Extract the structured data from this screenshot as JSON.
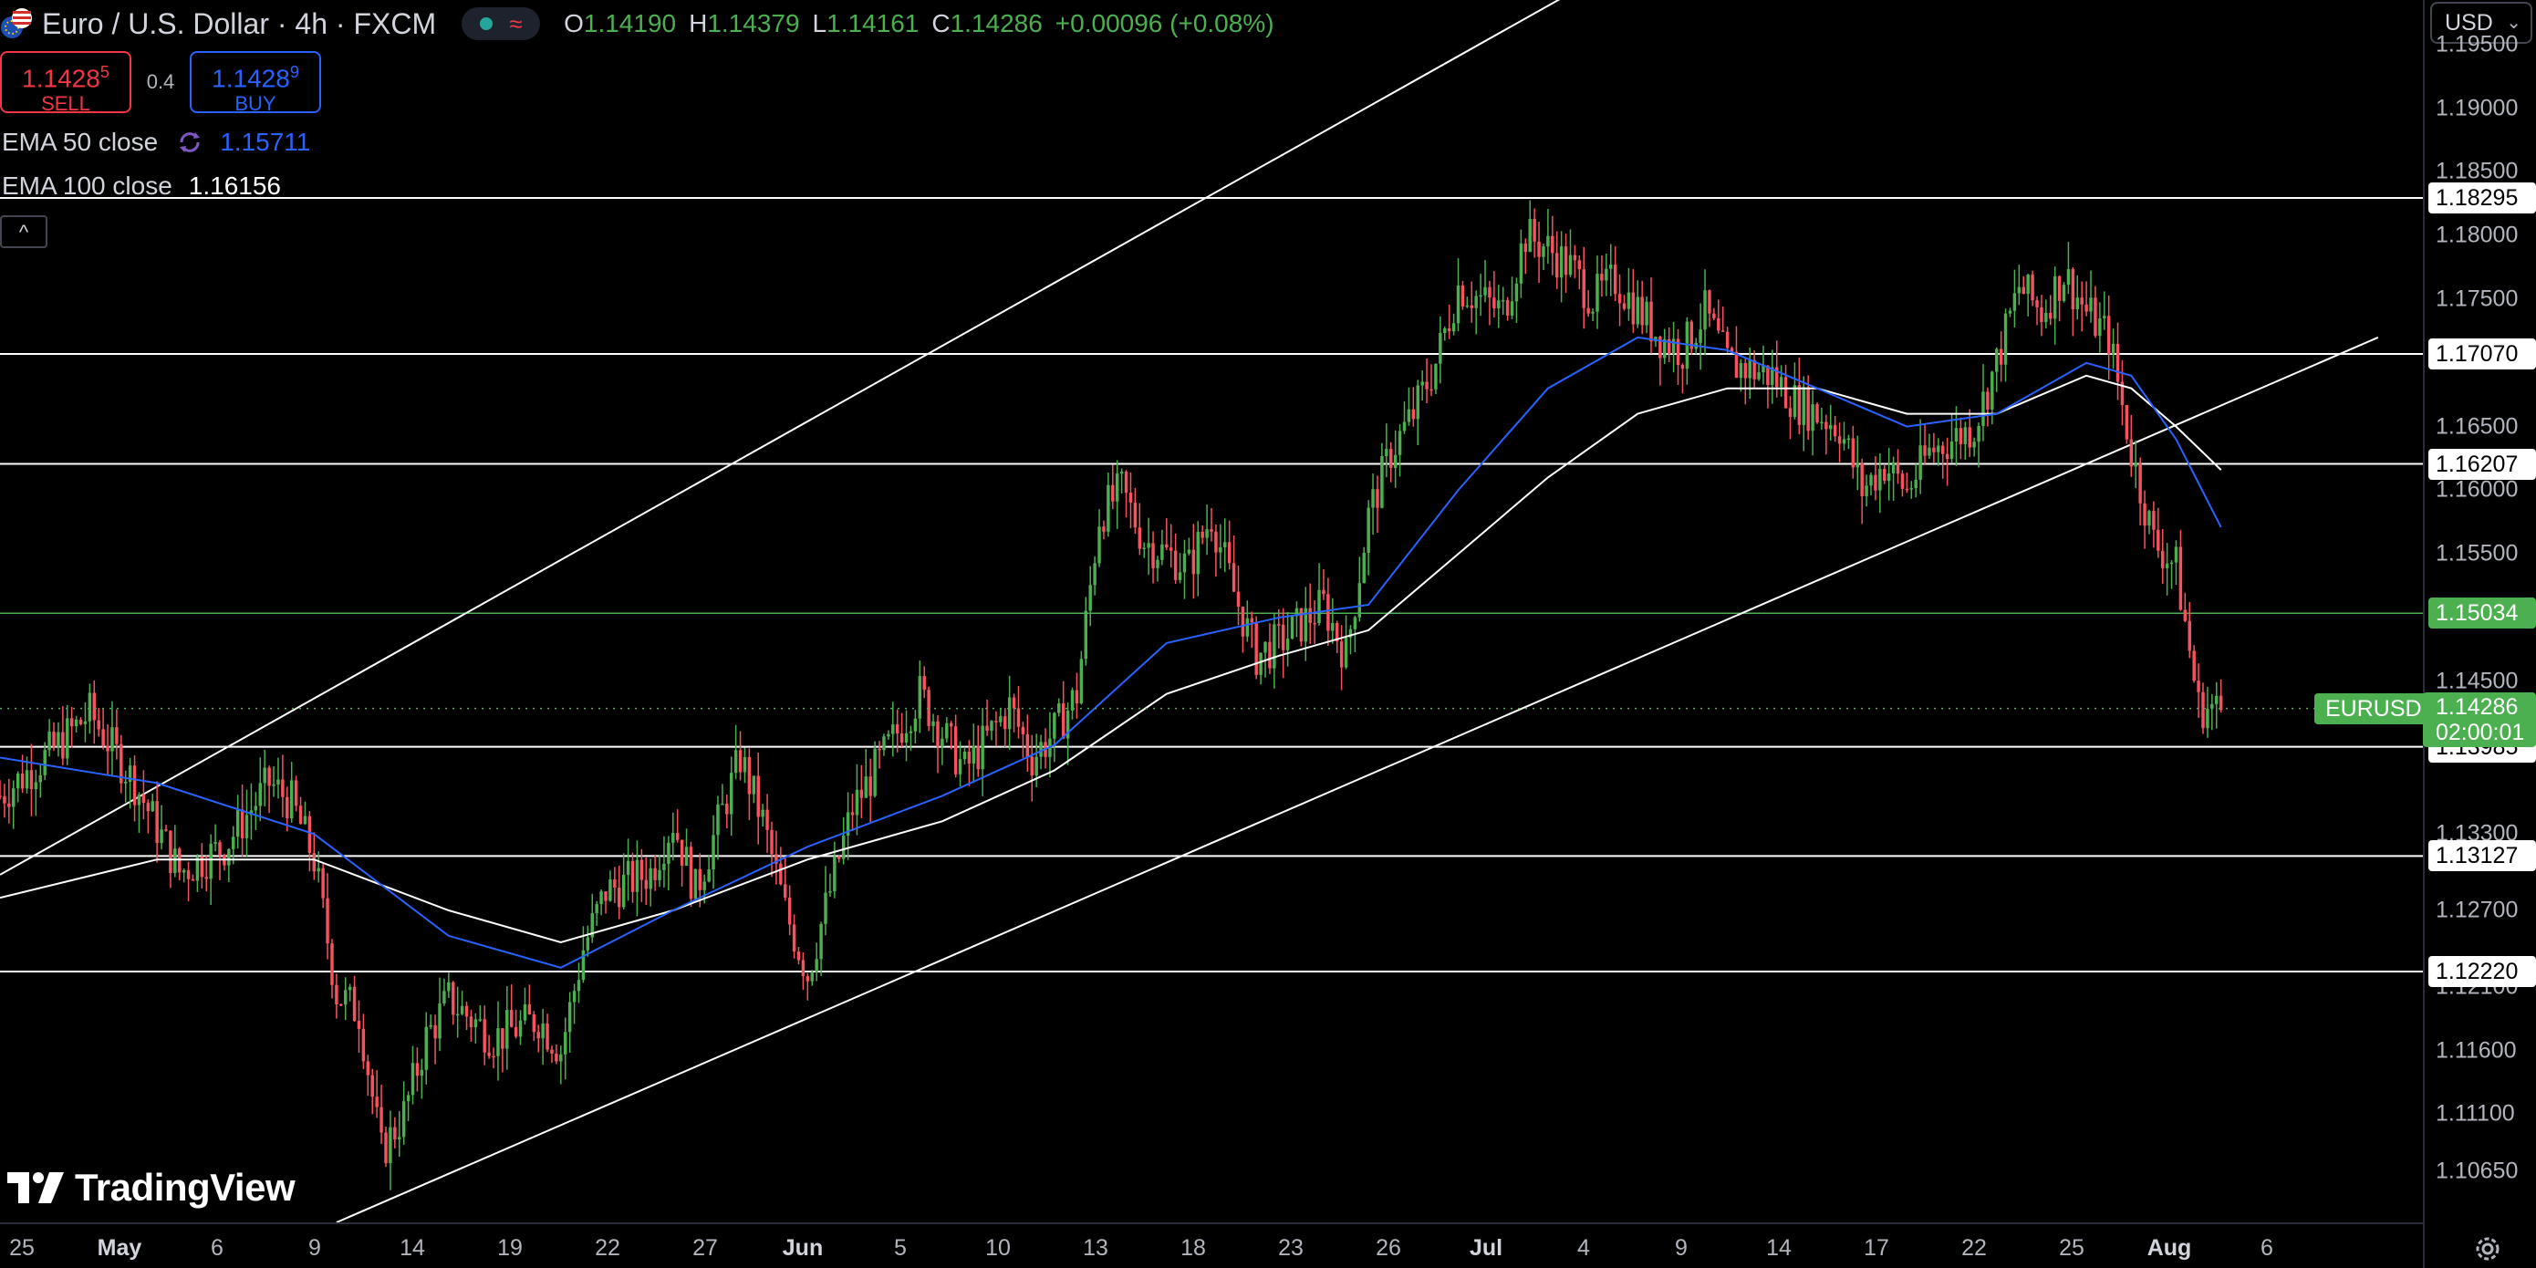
{
  "header": {
    "title": "Euro / U.S. Dollar · 4h · FXCM",
    "ohlc": [
      {
        "key": "O",
        "value": "1.14190"
      },
      {
        "key": "H",
        "value": "1.14379"
      },
      {
        "key": "L",
        "value": "1.14161"
      },
      {
        "key": "C",
        "value": "1.14286"
      }
    ],
    "change": "+0.00096 (+0.08%)",
    "status_icons": [
      "market-open-dot-icon",
      "data-delay-wave-icon"
    ]
  },
  "trade": {
    "sell_price_main": "1.1428",
    "sell_price_pip": "5",
    "sell_label": "SELL",
    "spread": "0.4",
    "buy_price_main": "1.1428",
    "buy_price_pip": "9",
    "buy_label": "BUY"
  },
  "indicators": {
    "ema50_label": "EMA 50 close",
    "ema50_value": "1.15711",
    "ema100_label": "EMA 100 close",
    "ema100_value": "1.16156",
    "collapse_glyph": "^"
  },
  "price_axis": {
    "currency": "USD",
    "ticks": [
      "1.19500",
      "1.19000",
      "1.18500",
      "1.18000",
      "1.17500",
      "1.16500",
      "1.16000",
      "1.15500",
      "1.14500",
      "1.13300",
      "1.12700",
      "1.12100",
      "1.11600",
      "1.11100",
      "1.10650"
    ],
    "last_price": "1.14286",
    "countdown": "02:00:01",
    "symbol": "EURUSD"
  },
  "time_axis": {
    "ticks": [
      {
        "label": "25",
        "bold": false
      },
      {
        "label": "May",
        "bold": true
      },
      {
        "label": "6",
        "bold": false
      },
      {
        "label": "9",
        "bold": false
      },
      {
        "label": "14",
        "bold": false
      },
      {
        "label": "19",
        "bold": false
      },
      {
        "label": "22",
        "bold": false
      },
      {
        "label": "27",
        "bold": false
      },
      {
        "label": "Jun",
        "bold": true
      },
      {
        "label": "5",
        "bold": false
      },
      {
        "label": "10",
        "bold": false
      },
      {
        "label": "13",
        "bold": false
      },
      {
        "label": "18",
        "bold": false
      },
      {
        "label": "23",
        "bold": false
      },
      {
        "label": "26",
        "bold": false
      },
      {
        "label": "Jul",
        "bold": true
      },
      {
        "label": "4",
        "bold": false
      },
      {
        "label": "9",
        "bold": false
      },
      {
        "label": "14",
        "bold": false
      },
      {
        "label": "17",
        "bold": false
      },
      {
        "label": "22",
        "bold": false
      },
      {
        "label": "25",
        "bold": false
      },
      {
        "label": "Aug",
        "bold": true
      },
      {
        "label": "6",
        "bold": false
      }
    ]
  },
  "colors": {
    "up": "#4caf50",
    "down": "#f7525f",
    "ema50": "#2962ff",
    "ema100": "#ffffff",
    "level_line": "#ffffff",
    "level_green": "#4caf50"
  },
  "branding": {
    "logo_text": "TradingView"
  },
  "chart_data": {
    "type": "candlestick",
    "instrument": "EURUSD",
    "timeframe": "4h",
    "ylim": [
      1.1025,
      1.1985
    ],
    "horizontal_levels": [
      {
        "price": "1.18295",
        "color": "white"
      },
      {
        "price": "1.17070",
        "color": "white"
      },
      {
        "price": "1.16207",
        "color": "white"
      },
      {
        "price": "1.15034",
        "color": "green"
      },
      {
        "price": "1.13985",
        "color": "white"
      },
      {
        "price": "1.13127",
        "color": "white"
      },
      {
        "price": "1.12220",
        "color": "white"
      }
    ],
    "channel": {
      "upper": [
        [
          "Apr 24",
          1.1298
        ],
        [
          "Jul 6",
          1.202
        ]
      ],
      "lower": [
        [
          "May 9",
          1.1025
        ],
        [
          "Aug 8",
          1.172
        ]
      ]
    },
    "ohlc_path": [
      [
        "Apr 24",
        1.136
      ],
      [
        "Apr 26",
        1.139
      ],
      [
        "Apr 28",
        1.1425
      ],
      [
        "Apr 30",
        1.137
      ],
      [
        "May 2",
        1.13
      ],
      [
        "May 4",
        1.132
      ],
      [
        "May 6",
        1.137
      ],
      [
        "May 7",
        1.1355
      ],
      [
        "May 8",
        1.131
      ],
      [
        "May 9",
        1.1205
      ],
      [
        "May 10",
        1.119
      ],
      [
        "May 11",
        1.108
      ],
      [
        "May 12",
        1.111
      ],
      [
        "May 13",
        1.117
      ],
      [
        "May 14",
        1.12
      ],
      [
        "May 16",
        1.117
      ],
      [
        "May 18",
        1.1185
      ],
      [
        "May 19",
        1.116
      ],
      [
        "May 20",
        1.124
      ],
      [
        "May 21",
        1.1285
      ],
      [
        "May 23",
        1.13
      ],
      [
        "May 24",
        1.134
      ],
      [
        "May 25",
        1.1285
      ],
      [
        "May 27",
        1.139
      ],
      [
        "May 28",
        1.134
      ],
      [
        "May 29",
        1.127
      ],
      [
        "May 30",
        1.122
      ],
      [
        "Jun 1",
        1.135
      ],
      [
        "Jun 3",
        1.141
      ],
      [
        "Jun 4",
        1.144
      ],
      [
        "Jun 6",
        1.138
      ],
      [
        "Jun 8",
        1.143
      ],
      [
        "Jun 9",
        1.139
      ],
      [
        "Jun 10",
        1.141
      ],
      [
        "Jun 11",
        1.144
      ],
      [
        "Jun 12",
        1.158
      ],
      [
        "Jun 13",
        1.16
      ],
      [
        "Jun 14",
        1.156
      ],
      [
        "Jun 16",
        1.154
      ],
      [
        "Jun 17",
        1.158
      ],
      [
        "Jun 18",
        1.152
      ],
      [
        "Jun 19",
        1.147
      ],
      [
        "Jun 20",
        1.148
      ],
      [
        "Jun 22",
        1.151
      ],
      [
        "Jun 23",
        1.147
      ],
      [
        "Jun 24",
        1.158
      ],
      [
        "Jun 25",
        1.163
      ],
      [
        "Jun 26",
        1.166
      ],
      [
        "Jun 27",
        1.17
      ],
      [
        "Jun 28",
        1.176
      ],
      [
        "Jun 30",
        1.174
      ],
      [
        "Jul 1",
        1.18
      ],
      [
        "Jul 2",
        1.179
      ],
      [
        "Jul 3",
        1.1775
      ],
      [
        "Jul 4",
        1.175
      ],
      [
        "Jul 5",
        1.1765
      ],
      [
        "Jul 7",
        1.172
      ],
      [
        "Jul 8",
        1.171
      ],
      [
        "Jul 9",
        1.174
      ],
      [
        "Jul 10",
        1.17
      ],
      [
        "Jul 12",
        1.169
      ],
      [
        "Jul 13",
        1.167
      ],
      [
        "Jul 14",
        1.166
      ],
      [
        "Jul 15",
        1.165
      ],
      [
        "Jul 16",
        1.16
      ],
      [
        "Jul 17",
        1.162
      ],
      [
        "Jul 18",
        1.16
      ],
      [
        "Jul 19",
        1.163
      ],
      [
        "Jul 21",
        1.165
      ],
      [
        "Jul 22",
        1.17
      ],
      [
        "Jul 23",
        1.176
      ],
      [
        "Jul 24",
        1.174
      ],
      [
        "Jul 25",
        1.177
      ],
      [
        "Jul 26",
        1.174
      ],
      [
        "Jul 27",
        1.172
      ],
      [
        "Jul 28",
        1.163
      ],
      [
        "Jul 29",
        1.156
      ],
      [
        "Jul 30",
        1.154
      ],
      [
        "Jul 31",
        1.143
      ],
      [
        "Aug 1",
        1.1428
      ]
    ],
    "ema50": [
      [
        "Apr 24",
        1.139
      ],
      [
        "May 1",
        1.137
      ],
      [
        "May 8",
        1.133
      ],
      [
        "May 14",
        1.125
      ],
      [
        "May 19",
        1.1225
      ],
      [
        "May 24",
        1.127
      ],
      [
        "May 30",
        1.132
      ],
      [
        "Jun 5",
        1.136
      ],
      [
        "Jun 10",
        1.14
      ],
      [
        "Jun 15",
        1.148
      ],
      [
        "Jun 20",
        1.15
      ],
      [
        "Jun 24",
        1.151
      ],
      [
        "Jun 28",
        1.16
      ],
      [
        "Jul 2",
        1.168
      ],
      [
        "Jul 6",
        1.172
      ],
      [
        "Jul 10",
        1.171
      ],
      [
        "Jul 14",
        1.168
      ],
      [
        "Jul 18",
        1.165
      ],
      [
        "Jul 22",
        1.166
      ],
      [
        "Jul 26",
        1.17
      ],
      [
        "Jul 28",
        1.169
      ],
      [
        "Jul 30",
        1.164
      ],
      [
        "Aug 1",
        1.1571
      ]
    ],
    "ema100": [
      [
        "Apr 24",
        1.128
      ],
      [
        "May 1",
        1.131
      ],
      [
        "May 8",
        1.131
      ],
      [
        "May 14",
        1.127
      ],
      [
        "May 19",
        1.1245
      ],
      [
        "May 24",
        1.127
      ],
      [
        "May 30",
        1.131
      ],
      [
        "Jun 5",
        1.134
      ],
      [
        "Jun 10",
        1.138
      ],
      [
        "Jun 15",
        1.144
      ],
      [
        "Jun 20",
        1.147
      ],
      [
        "Jun 24",
        1.149
      ],
      [
        "Jun 28",
        1.155
      ],
      [
        "Jul 2",
        1.161
      ],
      [
        "Jul 6",
        1.166
      ],
      [
        "Jul 10",
        1.168
      ],
      [
        "Jul 14",
        1.168
      ],
      [
        "Jul 18",
        1.166
      ],
      [
        "Jul 22",
        1.166
      ],
      [
        "Jul 26",
        1.169
      ],
      [
        "Jul 28",
        1.168
      ],
      [
        "Jul 30",
        1.165
      ],
      [
        "Aug 1",
        1.1616
      ]
    ]
  }
}
